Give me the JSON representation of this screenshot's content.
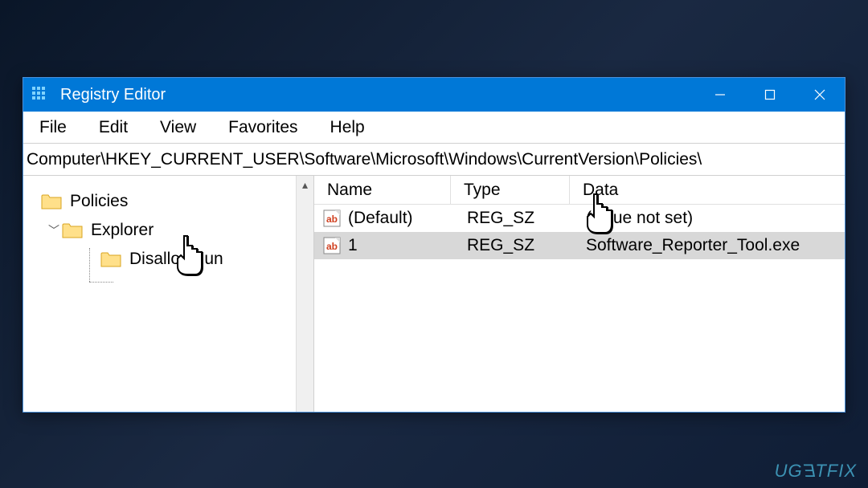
{
  "window": {
    "title": "Registry Editor"
  },
  "menu": {
    "file": "File",
    "edit": "Edit",
    "view": "View",
    "favorites": "Favorites",
    "help": "Help"
  },
  "address": "Computer\\HKEY_CURRENT_USER\\Software\\Microsoft\\Windows\\CurrentVersion\\Policies\\",
  "tree": {
    "node0": {
      "label": "Policies"
    },
    "node1": {
      "label": "Explorer"
    },
    "node2": {
      "label": "DisallowRun"
    }
  },
  "columns": {
    "name": "Name",
    "type": "Type",
    "data": "Data"
  },
  "values": [
    {
      "name": "(Default)",
      "type": "REG_SZ",
      "data": "(value not set)"
    },
    {
      "name": "1",
      "type": "REG_SZ",
      "data": "Software_Reporter_Tool.exe"
    }
  ],
  "watermark": "UGETFIX"
}
